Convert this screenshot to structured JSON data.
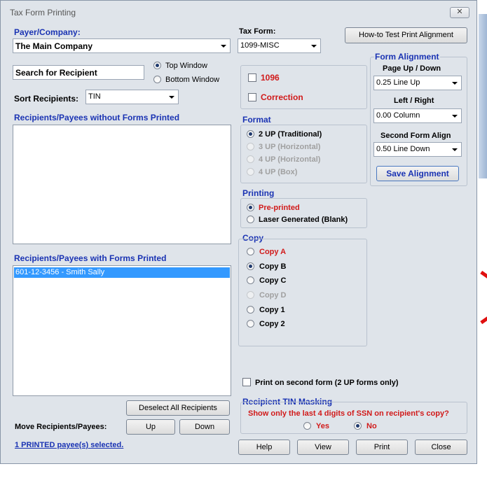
{
  "window": {
    "title": "Tax Form Printing",
    "close_glyph": "✕"
  },
  "payer": {
    "label": "Payer/Company:",
    "selected": "The Main Company"
  },
  "tax_form": {
    "label": "Tax Form:",
    "selected": "1099-MISC"
  },
  "how_to_button": "How-to Test Print  Alignment",
  "search": {
    "value": "Search for Recipient"
  },
  "window_choice": {
    "options": [
      "Top Window",
      "Bottom Window"
    ],
    "selected": "Top Window"
  },
  "sort": {
    "label": "Sort Recipients:",
    "selected": "TIN"
  },
  "list_without": {
    "label": "Recipients/Payees without Forms Printed",
    "items": []
  },
  "list_with": {
    "label": "Recipients/Payees with Forms Printed",
    "items": [
      "601-12-3456 - Smith  Sally"
    ]
  },
  "deselect_button": "Deselect All Recipients",
  "move": {
    "label": "Move Recipients/Payees:",
    "up": "Up",
    "down": "Down"
  },
  "status_link": "1 PRINTED payee(s) selected.",
  "checkboxes": {
    "c1096": "1096",
    "correction": "Correction"
  },
  "format": {
    "label": "Format",
    "options": [
      {
        "label": "2 UP (Traditional)",
        "checked": true,
        "enabled": true
      },
      {
        "label": "3 UP (Horizontal)",
        "checked": false,
        "enabled": false
      },
      {
        "label": "4 UP (Horizontal)",
        "checked": false,
        "enabled": false
      },
      {
        "label": "4 UP (Box)",
        "checked": false,
        "enabled": false
      }
    ]
  },
  "printing": {
    "label": "Printing",
    "options": [
      {
        "label": "Pre-printed",
        "checked": true
      },
      {
        "label": "Laser Generated (Blank)",
        "checked": false
      }
    ]
  },
  "copy": {
    "label": "Copy",
    "options": [
      {
        "label": "Copy A",
        "checked": false,
        "style": "red"
      },
      {
        "label": "Copy B",
        "checked": true,
        "style": "normal"
      },
      {
        "label": "Copy C",
        "checked": false,
        "style": "normal"
      },
      {
        "label": "Copy D",
        "checked": false,
        "style": "disabled"
      },
      {
        "label": "Copy 1",
        "checked": false,
        "style": "normal"
      },
      {
        "label": "Copy 2",
        "checked": false,
        "style": "normal"
      }
    ]
  },
  "alignment": {
    "label": "Form Alignment",
    "page_label": "Page Up / Down",
    "page_value": "0.25 Line Up",
    "lr_label": "Left / Right",
    "lr_value": "0.00 Column",
    "second_label": "Second Form Align",
    "second_value": "0.50 Line Down",
    "save_button": "Save  Alignment"
  },
  "second_form": {
    "label": "Print on second form (2 UP forms only)",
    "checked": false
  },
  "tin_masking": {
    "label": "Recipient TIN Masking",
    "question": "Show only the last 4 digits of SSN on recipient's copy?",
    "yes": "Yes",
    "no": "No",
    "selected": "No"
  },
  "footer_buttons": {
    "help": "Help",
    "view": "View",
    "print": "Print",
    "close": "Close"
  },
  "colors": {
    "accent_blue": "#1a33b3",
    "warning_red": "#d11a1a",
    "selection": "#3399ff",
    "window_bg": "#dfe4ea"
  }
}
